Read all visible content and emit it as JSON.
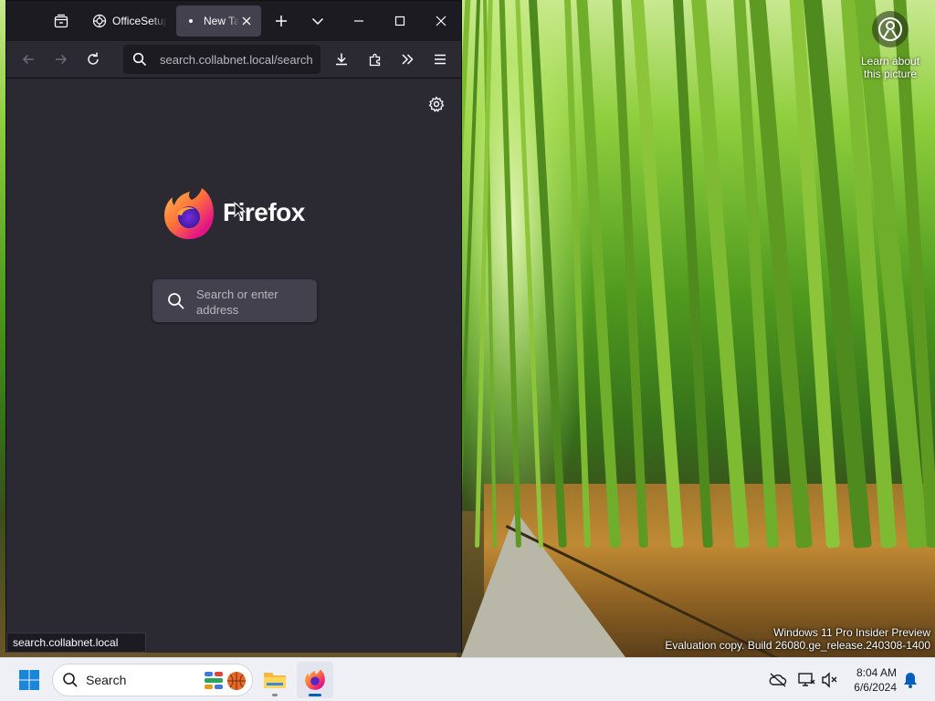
{
  "desktop": {
    "learn_label": "Learn about this picture",
    "watermark_line1": "Windows 11 Pro Insider Preview",
    "watermark_line2": "Evaluation copy. Build 26080.ge_release.240308-1400"
  },
  "browser": {
    "tabs": [
      {
        "title": "OfficeSetup",
        "icon": "officesetup-favicon-icon",
        "active": false
      },
      {
        "title": "New Tab",
        "icon": "dot-icon",
        "active": true
      }
    ],
    "url": "search.collabnet.local/search",
    "brand": "Firefox",
    "search_placeholder": "Search or enter address",
    "status_text": "search.collabnet.local",
    "accent": "#2b2a33"
  },
  "taskbar": {
    "search_label": "Search",
    "time": "8:04 AM",
    "date": "6/6/2024",
    "accent": "#005fb8"
  }
}
